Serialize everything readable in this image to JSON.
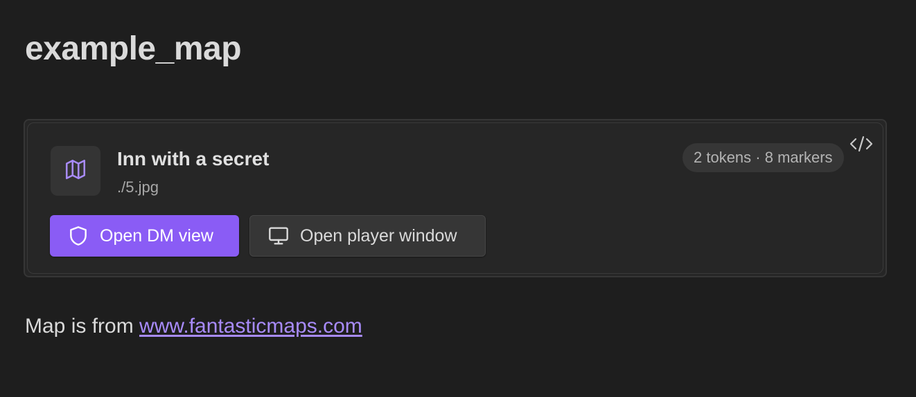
{
  "page": {
    "title": "example_map"
  },
  "map_card": {
    "icon": "map-icon",
    "title": "Inn with a secret",
    "path": "./5.jpg",
    "stats": "2 tokens · 8 markers",
    "code_toggle_icon": "code-icon",
    "buttons": {
      "dm_view": {
        "label": "Open DM view",
        "icon": "shield-icon"
      },
      "player_window": {
        "label": "Open player window",
        "icon": "monitor-icon"
      }
    }
  },
  "footer": {
    "prefix": "Map is from ",
    "link_text": "www.fantasticmaps.com"
  },
  "colors": {
    "background": "#1e1e1e",
    "card": "#262626",
    "accent": "#8a5cf5",
    "link": "#a88bfa",
    "text": "#dadada",
    "muted": "#a8a8a8"
  }
}
